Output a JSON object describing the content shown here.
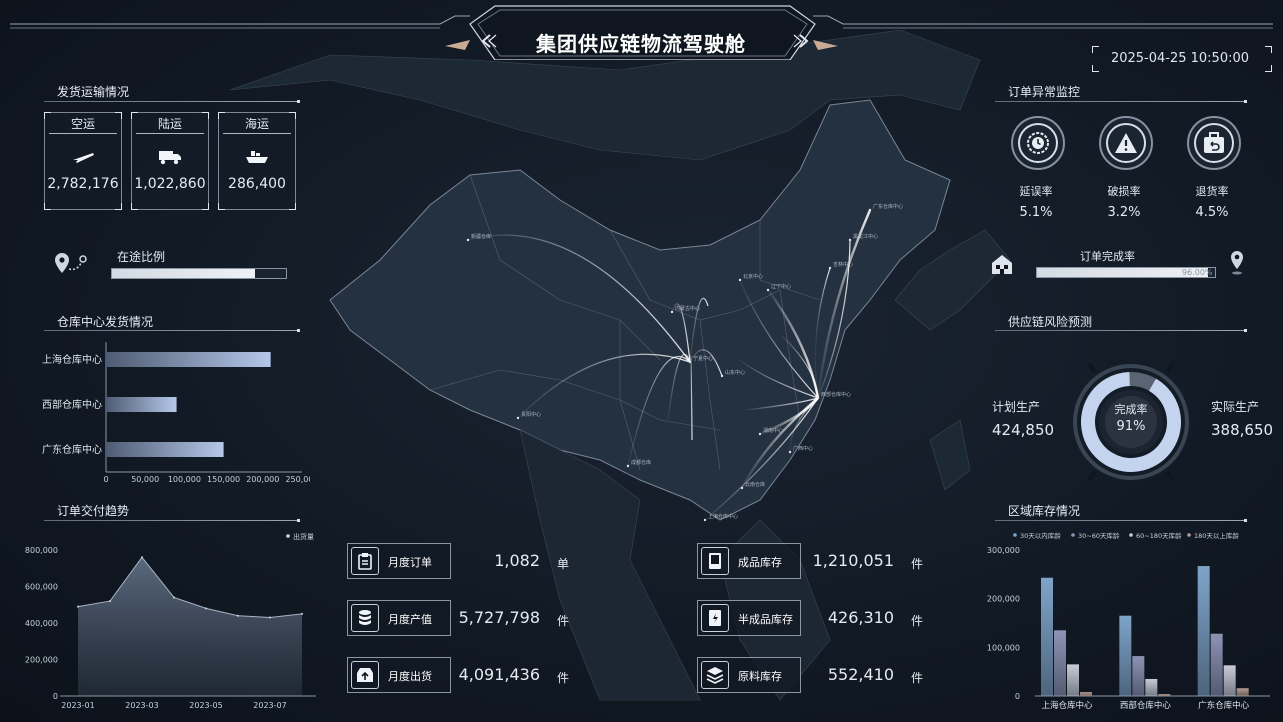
{
  "header": {
    "title": "集团供应链物流驾驶舱",
    "datetime": "2025-04-25 10:50:00"
  },
  "shipping": {
    "title": "发货运输情况",
    "cards": [
      {
        "label": "空运",
        "value": "2,782,176",
        "icon": "airplane-icon"
      },
      {
        "label": "陆运",
        "value": "1,022,860",
        "icon": "truck-icon"
      },
      {
        "label": "海运",
        "value": "286,400",
        "icon": "ship-icon"
      }
    ],
    "in_transit": {
      "label": "在途比例",
      "value_text": "82.00%",
      "value": 0.82
    }
  },
  "warehouse": {
    "title": "仓库中心发货情况",
    "chart_data": {
      "type": "bar",
      "orientation": "horizontal",
      "categories": [
        "上海仓库中心",
        "西部仓库中心",
        "广东仓库中心"
      ],
      "values": [
        210000,
        90000,
        150000
      ],
      "xlim": [
        0,
        250000
      ],
      "ticks": [
        "0",
        "50,000",
        "100,000",
        "150,000",
        "200,000",
        "250,000"
      ]
    }
  },
  "trend": {
    "title": "订单交付趋势",
    "chart_data": {
      "type": "area",
      "legend": "出货量",
      "x": [
        "2023-01",
        "2023-02",
        "2023-03",
        "2023-04",
        "2023-05",
        "2023-06",
        "2023-07",
        "2023-08"
      ],
      "values": [
        490000,
        520000,
        760000,
        540000,
        480000,
        440000,
        430000,
        450000
      ],
      "ylim": [
        0,
        800000
      ],
      "yticks": [
        "800,000",
        "600,000",
        "400,000",
        "200,000",
        "0"
      ],
      "xticks": [
        "2023-01",
        "2023-03",
        "2023-05",
        "2023-07"
      ]
    }
  },
  "stats_left": [
    {
      "label": "月度订单",
      "value": "1,082",
      "unit": "单",
      "icon": "clipboard-icon"
    },
    {
      "label": "月度产值",
      "value": "5,727,798",
      "unit": "件",
      "icon": "database-icon"
    },
    {
      "label": "月度出货",
      "value": "4,091,436",
      "unit": "件",
      "icon": "outbox-icon"
    }
  ],
  "stats_right": [
    {
      "label": "成品库存",
      "value": "1,210,051",
      "unit": "件",
      "icon": "monitor-icon"
    },
    {
      "label": "半成品库存",
      "value": "426,310",
      "unit": "件",
      "icon": "half-product-icon"
    },
    {
      "label": "原料库存",
      "value": "552,410",
      "unit": "件",
      "icon": "layers-icon"
    }
  ],
  "anomaly": {
    "title": "订单异常监控",
    "items": [
      {
        "label": "延误率",
        "value": "5.1%",
        "icon": "clock-icon"
      },
      {
        "label": "破损率",
        "value": "3.2%",
        "icon": "warning-icon"
      },
      {
        "label": "退货率",
        "value": "4.5%",
        "icon": "return-icon"
      }
    ],
    "completion": {
      "label": "订单完成率",
      "value_text": "96.00%",
      "value": 0.96
    }
  },
  "risk": {
    "title": "供应链风险预测",
    "plan_label": "计划生产",
    "plan_value": "424,850",
    "actual_label": "实际生产",
    "actual_value": "388,650",
    "rate_label": "完成率",
    "rate_value": "91%",
    "rate": 0.91
  },
  "inventory": {
    "title": "区域库存情况",
    "chart_data": {
      "type": "bar",
      "categories": [
        "上海仓库中心",
        "西部仓库中心",
        "广东仓库中心"
      ],
      "series": [
        {
          "name": "30天以内库龄",
          "values": [
            243000,
            165000,
            267000
          ],
          "color": "#7fa4c9"
        },
        {
          "name": "30~60天库龄",
          "values": [
            135000,
            82000,
            128000
          ],
          "color": "#8d93b3"
        },
        {
          "name": "60~180天库龄",
          "values": [
            65000,
            35000,
            63000
          ],
          "color": "#c9ccd6"
        },
        {
          "name": "180天以上库龄",
          "values": [
            8000,
            4000,
            16000
          ],
          "color": "#b69a90"
        }
      ],
      "ylim": [
        0,
        300000
      ],
      "yticks": [
        "300,000",
        "200,000",
        "100,000",
        "0"
      ]
    }
  },
  "map": {
    "cities": [
      "新疆仓库",
      "内蒙古中心",
      "宁夏中心",
      "西部仓库中心",
      "成都仓库",
      "贵阳中心",
      "云南仓库",
      "上海仓库中心",
      "广东仓库中心",
      "黑龙江中心",
      "吉林中心",
      "辽宁中心",
      "山东中心",
      "湖南中心",
      "广西中心",
      "北京中心"
    ]
  }
}
